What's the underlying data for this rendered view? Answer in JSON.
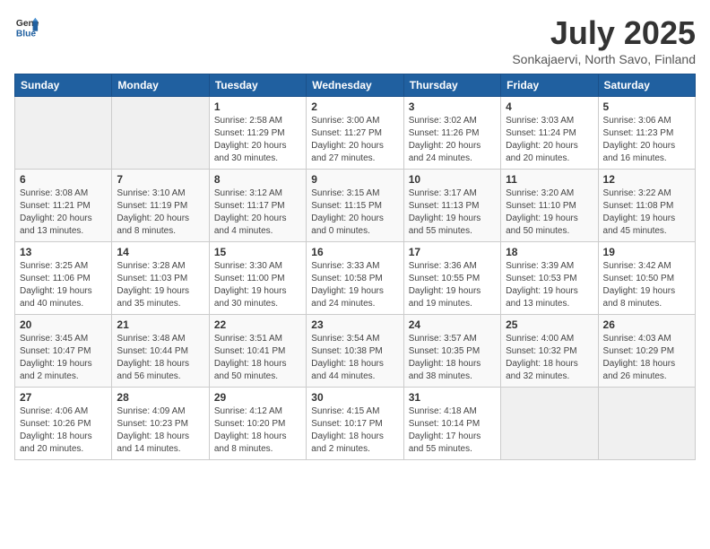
{
  "logo": {
    "general": "General",
    "blue": "Blue"
  },
  "title": "July 2025",
  "location": "Sonkajaervi, North Savo, Finland",
  "days_header": [
    "Sunday",
    "Monday",
    "Tuesday",
    "Wednesday",
    "Thursday",
    "Friday",
    "Saturday"
  ],
  "weeks": [
    [
      {
        "day": "",
        "info": ""
      },
      {
        "day": "",
        "info": ""
      },
      {
        "day": "1",
        "info": "Sunrise: 2:58 AM\nSunset: 11:29 PM\nDaylight: 20 hours\nand 30 minutes."
      },
      {
        "day": "2",
        "info": "Sunrise: 3:00 AM\nSunset: 11:27 PM\nDaylight: 20 hours\nand 27 minutes."
      },
      {
        "day": "3",
        "info": "Sunrise: 3:02 AM\nSunset: 11:26 PM\nDaylight: 20 hours\nand 24 minutes."
      },
      {
        "day": "4",
        "info": "Sunrise: 3:03 AM\nSunset: 11:24 PM\nDaylight: 20 hours\nand 20 minutes."
      },
      {
        "day": "5",
        "info": "Sunrise: 3:06 AM\nSunset: 11:23 PM\nDaylight: 20 hours\nand 16 minutes."
      }
    ],
    [
      {
        "day": "6",
        "info": "Sunrise: 3:08 AM\nSunset: 11:21 PM\nDaylight: 20 hours\nand 13 minutes."
      },
      {
        "day": "7",
        "info": "Sunrise: 3:10 AM\nSunset: 11:19 PM\nDaylight: 20 hours\nand 8 minutes."
      },
      {
        "day": "8",
        "info": "Sunrise: 3:12 AM\nSunset: 11:17 PM\nDaylight: 20 hours\nand 4 minutes."
      },
      {
        "day": "9",
        "info": "Sunrise: 3:15 AM\nSunset: 11:15 PM\nDaylight: 20 hours\nand 0 minutes."
      },
      {
        "day": "10",
        "info": "Sunrise: 3:17 AM\nSunset: 11:13 PM\nDaylight: 19 hours\nand 55 minutes."
      },
      {
        "day": "11",
        "info": "Sunrise: 3:20 AM\nSunset: 11:10 PM\nDaylight: 19 hours\nand 50 minutes."
      },
      {
        "day": "12",
        "info": "Sunrise: 3:22 AM\nSunset: 11:08 PM\nDaylight: 19 hours\nand 45 minutes."
      }
    ],
    [
      {
        "day": "13",
        "info": "Sunrise: 3:25 AM\nSunset: 11:06 PM\nDaylight: 19 hours\nand 40 minutes."
      },
      {
        "day": "14",
        "info": "Sunrise: 3:28 AM\nSunset: 11:03 PM\nDaylight: 19 hours\nand 35 minutes."
      },
      {
        "day": "15",
        "info": "Sunrise: 3:30 AM\nSunset: 11:00 PM\nDaylight: 19 hours\nand 30 minutes."
      },
      {
        "day": "16",
        "info": "Sunrise: 3:33 AM\nSunset: 10:58 PM\nDaylight: 19 hours\nand 24 minutes."
      },
      {
        "day": "17",
        "info": "Sunrise: 3:36 AM\nSunset: 10:55 PM\nDaylight: 19 hours\nand 19 minutes."
      },
      {
        "day": "18",
        "info": "Sunrise: 3:39 AM\nSunset: 10:53 PM\nDaylight: 19 hours\nand 13 minutes."
      },
      {
        "day": "19",
        "info": "Sunrise: 3:42 AM\nSunset: 10:50 PM\nDaylight: 19 hours\nand 8 minutes."
      }
    ],
    [
      {
        "day": "20",
        "info": "Sunrise: 3:45 AM\nSunset: 10:47 PM\nDaylight: 19 hours\nand 2 minutes."
      },
      {
        "day": "21",
        "info": "Sunrise: 3:48 AM\nSunset: 10:44 PM\nDaylight: 18 hours\nand 56 minutes."
      },
      {
        "day": "22",
        "info": "Sunrise: 3:51 AM\nSunset: 10:41 PM\nDaylight: 18 hours\nand 50 minutes."
      },
      {
        "day": "23",
        "info": "Sunrise: 3:54 AM\nSunset: 10:38 PM\nDaylight: 18 hours\nand 44 minutes."
      },
      {
        "day": "24",
        "info": "Sunrise: 3:57 AM\nSunset: 10:35 PM\nDaylight: 18 hours\nand 38 minutes."
      },
      {
        "day": "25",
        "info": "Sunrise: 4:00 AM\nSunset: 10:32 PM\nDaylight: 18 hours\nand 32 minutes."
      },
      {
        "day": "26",
        "info": "Sunrise: 4:03 AM\nSunset: 10:29 PM\nDaylight: 18 hours\nand 26 minutes."
      }
    ],
    [
      {
        "day": "27",
        "info": "Sunrise: 4:06 AM\nSunset: 10:26 PM\nDaylight: 18 hours\nand 20 minutes."
      },
      {
        "day": "28",
        "info": "Sunrise: 4:09 AM\nSunset: 10:23 PM\nDaylight: 18 hours\nand 14 minutes."
      },
      {
        "day": "29",
        "info": "Sunrise: 4:12 AM\nSunset: 10:20 PM\nDaylight: 18 hours\nand 8 minutes."
      },
      {
        "day": "30",
        "info": "Sunrise: 4:15 AM\nSunset: 10:17 PM\nDaylight: 18 hours\nand 2 minutes."
      },
      {
        "day": "31",
        "info": "Sunrise: 4:18 AM\nSunset: 10:14 PM\nDaylight: 17 hours\nand 55 minutes."
      },
      {
        "day": "",
        "info": ""
      },
      {
        "day": "",
        "info": ""
      }
    ]
  ]
}
